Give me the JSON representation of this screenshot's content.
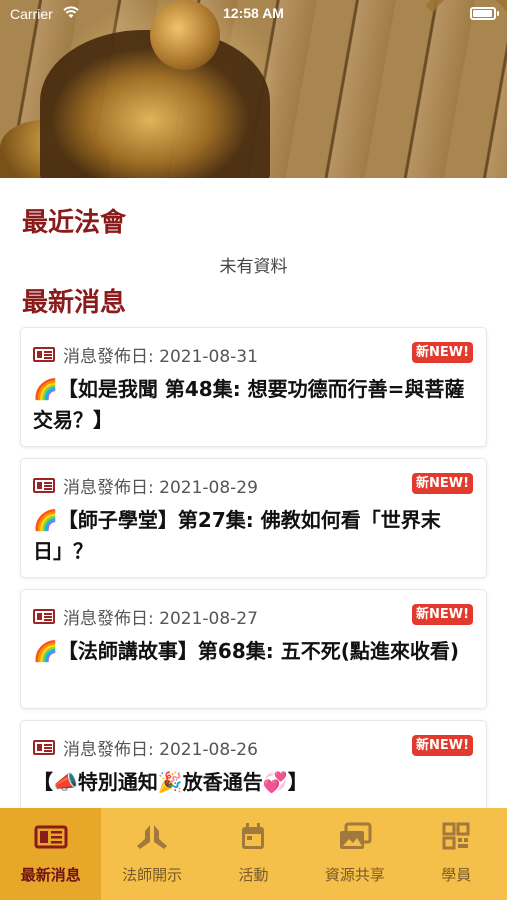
{
  "status_bar": {
    "carrier": "Carrier",
    "time": "12:58 AM",
    "battery_level": 0.95
  },
  "sections": {
    "recent_events_title": "最近法會",
    "recent_events_empty": "未有資料",
    "latest_news_title": "最新消息"
  },
  "news": [
    {
      "date_label": "消息發佈日: 2021-08-31",
      "badge": "新NEW!",
      "title": "🌈【如是我聞 第48集: 想要功德而行善=與菩薩交易？】"
    },
    {
      "date_label": "消息發佈日: 2021-08-29",
      "badge": "新NEW!",
      "title": "🌈【師子學堂】第27集: 佛教如何看「世界末日」？"
    },
    {
      "date_label": "消息發佈日: 2021-08-27",
      "badge": "新NEW!",
      "title": "🌈【法師講故事】第68集: 五不死(點進來收看)"
    },
    {
      "date_label": "消息發佈日: 2021-08-26",
      "badge": "新NEW!",
      "title": "【📣特別通知🎉放香通告💞】"
    }
  ],
  "tabs": [
    {
      "label": "最新消息",
      "icon": "newspaper-icon",
      "active": true
    },
    {
      "label": "法師開示",
      "icon": "praying-hands-icon",
      "active": false
    },
    {
      "label": "活動",
      "icon": "calendar-icon",
      "active": false
    },
    {
      "label": "資源共享",
      "icon": "images-icon",
      "active": false
    },
    {
      "label": "學員",
      "icon": "qr-code-icon",
      "active": false
    }
  ],
  "colors": {
    "accent": "#8b1a1a",
    "tab_bar": "#f5c04a",
    "tab_active": "#e7a729",
    "badge": "#e23b2e"
  }
}
